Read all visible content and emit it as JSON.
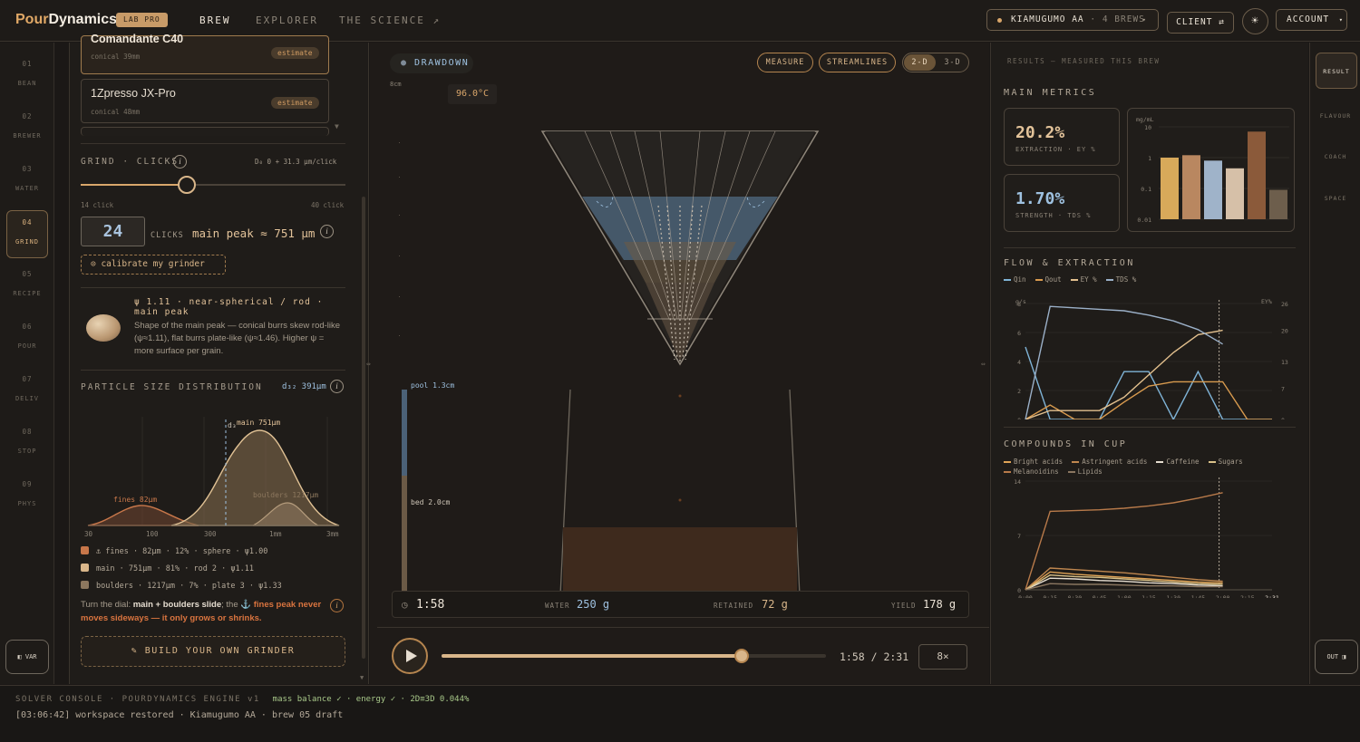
{
  "app": {
    "brand_pour": "Pour",
    "brand_dynamics": "Dynamics",
    "badge": "LAB PRO"
  },
  "nav": {
    "tabs": [
      "BREW",
      "EXPLORER",
      "THE SCIENCE ↗"
    ]
  },
  "header": {
    "bean_name": "KIAMUGUMO AA",
    "bean_meta": "· 4 BREWS",
    "client_label": "CLIENT ⇄",
    "account_label": "ACCOUNT"
  },
  "steps": [
    {
      "n": "01",
      "label": "BEAN"
    },
    {
      "n": "02",
      "label": "BREWER"
    },
    {
      "n": "03",
      "label": "WATER"
    },
    {
      "n": "04",
      "label": "GRIND"
    },
    {
      "n": "05",
      "label": "RECIPE"
    },
    {
      "n": "06",
      "label": "POUR"
    },
    {
      "n": "07",
      "label": "DELIV"
    },
    {
      "n": "08",
      "label": "STOP"
    },
    {
      "n": "09",
      "label": "PHYS"
    }
  ],
  "rail_var": "◧ VAR",
  "grinders": [
    {
      "name": "Comandante C40",
      "meta": "conical 39mm",
      "tag": "estimate"
    },
    {
      "name": "1Zpresso JX-Pro",
      "meta": "conical 48mm",
      "tag": "estimate"
    }
  ],
  "grind": {
    "title": "GRIND · CLICKS",
    "formula": "D₀ 0 + 31.3 μm/click",
    "min_label": "14 click",
    "max_label": "40 click",
    "slider_fraction": 0.4,
    "value": "24",
    "unit": "CLICKS",
    "peak": "main peak ≈ 751 μm",
    "calibrate": "⊙ calibrate my grinder"
  },
  "shape": {
    "title": "ψ 1.11 · near-spherical / rod · main peak",
    "desc": "Shape of the main peak — conical burrs skew rod-like (ψ≈1.11), flat burrs plate-like (ψ≈1.46). Higher ψ = more surface per grain."
  },
  "psd": {
    "title": "PARTICLE SIZE DISTRIBUTION",
    "d32": "d₃₂ 391μm",
    "x_ticks": [
      "30",
      "100",
      "300",
      "1mm",
      "3mm"
    ],
    "labels": {
      "main": "main 751μm",
      "d": "d₃",
      "fines": "fines 82μm",
      "boulders": "boulders 1217μm"
    },
    "legend": [
      {
        "text": "⚓ fines · 82μm · 12% · sphere · ψ1.00",
        "color": "#c8774a"
      },
      {
        "text": "main · 751μm · 81% · rod 2 · ψ1.11",
        "color": "#d9b68a"
      },
      {
        "text": "boulders · 1217μm · 7% · plate 3 · ψ1.33",
        "color": "#8c775e"
      }
    ],
    "note_a": "Turn the dial: ",
    "note_b": "main + boulders slide",
    "note_c": "; the ⚓ ",
    "note_d": "fines peak never moves sideways — it only grows or shrinks.",
    "build": "✎ BUILD YOUR OWN GRINDER"
  },
  "center": {
    "mode": "DRAWDOWN",
    "buttons": [
      "MEASURE",
      "STREAMLINES"
    ],
    "dims": [
      "2-D",
      "3-D"
    ],
    "scale": "8cm",
    "temp": "96.0°C",
    "pool": "pool 1.3cm",
    "bed": "bed 2.0cm",
    "time": "1:58",
    "water_label": "WATER",
    "water": "250 g",
    "retained_label": "RETAINED",
    "retained": "72 g",
    "yield_label": "YIELD",
    "yield": "178 g",
    "playback": "1:58 / 2:31",
    "speed": "8×",
    "progress": 0.78
  },
  "right": {
    "results_title": "RESULTS — MEASURED THIS BREW",
    "main_metrics": "MAIN METRICS",
    "ey_value": "20.2%",
    "ey_label": "EXTRACTION · EY %",
    "tds_value": "1.70%",
    "tds_label": "STRENGTH · TDS %",
    "bar_unit": "mg/mL",
    "bar_ticks": [
      "10",
      "1",
      "0.1",
      "0.01"
    ],
    "flow_title": "FLOW & EXTRACTION",
    "flow_legend": [
      "Qin",
      "Qout",
      "EY %",
      "TDS %"
    ],
    "flow_left_unit": "g/s",
    "flow_right_unit": "EY%",
    "flow_y_left": [
      "8",
      "6",
      "4",
      "2",
      "0"
    ],
    "flow_y_right": [
      "26",
      "20",
      "13",
      "7",
      "0"
    ],
    "x_ticks": [
      "0:00",
      "0:15",
      "0:30",
      "0:45",
      "1:00",
      "1:15",
      "1:30",
      "1:45",
      "2:00",
      "2:15",
      "2:31"
    ],
    "compounds_title": "COMPOUNDS IN CUP",
    "compounds_legend": [
      "Bright acids",
      "Astringent acids",
      "Caffeine",
      "Sugars",
      "Melanoidins",
      "Lipids"
    ],
    "comp_y": [
      "14",
      "7",
      "0"
    ]
  },
  "rtabs": [
    "RESULT",
    "FLAVOUR",
    "COACH",
    "SPACE"
  ],
  "rtab_out": "OUT ◨",
  "chart_data": [
    {
      "type": "bar",
      "title": "",
      "ylabel": "mg/mL",
      "scale": "log",
      "ylim": [
        0.01,
        10
      ],
      "categories": [
        "",
        "",
        "",
        "",
        "",
        ""
      ],
      "values": [
        1.0,
        1.2,
        0.8,
        0.45,
        7.0,
        0.09
      ],
      "colors": [
        "#d8a95a",
        "#b98760",
        "#9fb3c9",
        "#d6c0a8",
        "#8b5a3a",
        "#6d5e4c"
      ]
    },
    {
      "type": "line",
      "title": "FLOW & EXTRACTION",
      "x": [
        "0:00",
        "0:15",
        "0:30",
        "0:45",
        "1:00",
        "1:15",
        "1:30",
        "1:45",
        "2:00",
        "2:15",
        "2:31"
      ],
      "series": [
        {
          "name": "Qin",
          "color": "#7fb3d6",
          "values": [
            5,
            0,
            0,
            0,
            3.3,
            3.3,
            0,
            3.3,
            0,
            0,
            0
          ]
        },
        {
          "name": "Qout",
          "color": "#d99b4f",
          "values": [
            0,
            1,
            0,
            0,
            1.2,
            2.3,
            2.6,
            2.6,
            2.6,
            0,
            0
          ]
        },
        {
          "name": "EY %",
          "color": "#e3c08e",
          "values": [
            0,
            2,
            2,
            2,
            5,
            10,
            15,
            19,
            20,
            null,
            null
          ]
        },
        {
          "name": "TDS %",
          "color": "#9bb0c8",
          "values": [
            0,
            7.8,
            7.7,
            7.6,
            7.5,
            7.2,
            6.8,
            6.2,
            5.2,
            null,
            null
          ]
        }
      ]
    },
    {
      "type": "line",
      "title": "COMPOUNDS IN CUP",
      "x": [
        "0:00",
        "0:15",
        "0:30",
        "0:45",
        "1:00",
        "1:15",
        "1:30",
        "1:45",
        "2:00",
        "2:15",
        "2:31"
      ],
      "ylim": [
        0,
        14
      ],
      "series": [
        {
          "name": "Bright acids",
          "color": "#e0a457",
          "values": [
            0,
            2.3,
            2.0,
            1.8,
            1.6,
            1.4,
            1.2,
            1.0,
            0.9,
            null,
            null
          ]
        },
        {
          "name": "Astringent acids",
          "color": "#c0874f",
          "values": [
            0,
            2.8,
            2.6,
            2.4,
            2.2,
            1.9,
            1.6,
            1.3,
            1.1,
            null,
            null
          ]
        },
        {
          "name": "Caffeine",
          "color": "#e6ddd0",
          "values": [
            0,
            1.5,
            1.4,
            1.2,
            1.1,
            0.9,
            0.8,
            0.6,
            0.5,
            null,
            null
          ]
        },
        {
          "name": "Sugars",
          "color": "#d9c189",
          "values": [
            0,
            1.9,
            1.7,
            1.6,
            1.4,
            1.2,
            1.0,
            0.8,
            0.7,
            null,
            null
          ]
        },
        {
          "name": "Melanoidins",
          "color": "#b87a4a",
          "values": [
            0,
            10.1,
            10.2,
            10.3,
            10.5,
            10.8,
            11.2,
            11.8,
            12.5,
            null,
            null
          ]
        },
        {
          "name": "Lipids",
          "color": "#8a7660",
          "values": [
            0,
            0.8,
            0.7,
            0.7,
            0.6,
            0.5,
            0.5,
            0.4,
            0.4,
            null,
            null
          ]
        }
      ]
    }
  ],
  "console": {
    "title": "SOLVER CONSOLE · POURDYNAMICS ENGINE v1",
    "status": "mass balance ✓ · energy ✓ · 2D≡3D 0.044%",
    "log": "[03:06:42] workspace restored · Kiamugumo AA · brew 05 draft"
  }
}
